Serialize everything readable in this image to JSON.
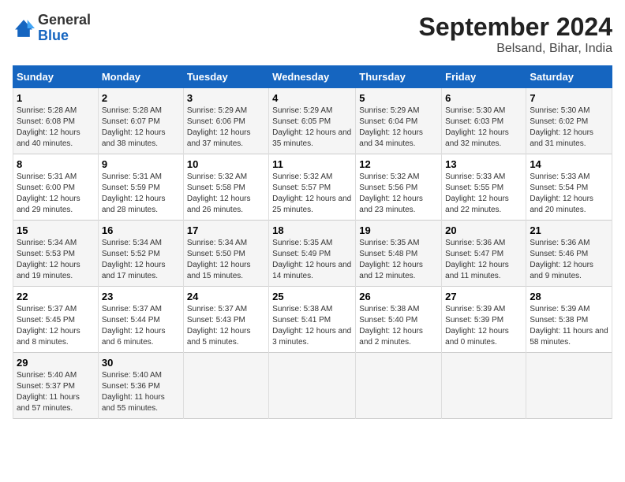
{
  "logo": {
    "general": "General",
    "blue": "Blue"
  },
  "title": "September 2024",
  "location": "Belsand, Bihar, India",
  "weekdays": [
    "Sunday",
    "Monday",
    "Tuesday",
    "Wednesday",
    "Thursday",
    "Friday",
    "Saturday"
  ],
  "weeks": [
    [
      {
        "day": "1",
        "sunrise": "Sunrise: 5:28 AM",
        "sunset": "Sunset: 6:08 PM",
        "daylight": "Daylight: 12 hours and 40 minutes."
      },
      {
        "day": "2",
        "sunrise": "Sunrise: 5:28 AM",
        "sunset": "Sunset: 6:07 PM",
        "daylight": "Daylight: 12 hours and 38 minutes."
      },
      {
        "day": "3",
        "sunrise": "Sunrise: 5:29 AM",
        "sunset": "Sunset: 6:06 PM",
        "daylight": "Daylight: 12 hours and 37 minutes."
      },
      {
        "day": "4",
        "sunrise": "Sunrise: 5:29 AM",
        "sunset": "Sunset: 6:05 PM",
        "daylight": "Daylight: 12 hours and 35 minutes."
      },
      {
        "day": "5",
        "sunrise": "Sunrise: 5:29 AM",
        "sunset": "Sunset: 6:04 PM",
        "daylight": "Daylight: 12 hours and 34 minutes."
      },
      {
        "day": "6",
        "sunrise": "Sunrise: 5:30 AM",
        "sunset": "Sunset: 6:03 PM",
        "daylight": "Daylight: 12 hours and 32 minutes."
      },
      {
        "day": "7",
        "sunrise": "Sunrise: 5:30 AM",
        "sunset": "Sunset: 6:02 PM",
        "daylight": "Daylight: 12 hours and 31 minutes."
      }
    ],
    [
      {
        "day": "8",
        "sunrise": "Sunrise: 5:31 AM",
        "sunset": "Sunset: 6:00 PM",
        "daylight": "Daylight: 12 hours and 29 minutes."
      },
      {
        "day": "9",
        "sunrise": "Sunrise: 5:31 AM",
        "sunset": "Sunset: 5:59 PM",
        "daylight": "Daylight: 12 hours and 28 minutes."
      },
      {
        "day": "10",
        "sunrise": "Sunrise: 5:32 AM",
        "sunset": "Sunset: 5:58 PM",
        "daylight": "Daylight: 12 hours and 26 minutes."
      },
      {
        "day": "11",
        "sunrise": "Sunrise: 5:32 AM",
        "sunset": "Sunset: 5:57 PM",
        "daylight": "Daylight: 12 hours and 25 minutes."
      },
      {
        "day": "12",
        "sunrise": "Sunrise: 5:32 AM",
        "sunset": "Sunset: 5:56 PM",
        "daylight": "Daylight: 12 hours and 23 minutes."
      },
      {
        "day": "13",
        "sunrise": "Sunrise: 5:33 AM",
        "sunset": "Sunset: 5:55 PM",
        "daylight": "Daylight: 12 hours and 22 minutes."
      },
      {
        "day": "14",
        "sunrise": "Sunrise: 5:33 AM",
        "sunset": "Sunset: 5:54 PM",
        "daylight": "Daylight: 12 hours and 20 minutes."
      }
    ],
    [
      {
        "day": "15",
        "sunrise": "Sunrise: 5:34 AM",
        "sunset": "Sunset: 5:53 PM",
        "daylight": "Daylight: 12 hours and 19 minutes."
      },
      {
        "day": "16",
        "sunrise": "Sunrise: 5:34 AM",
        "sunset": "Sunset: 5:52 PM",
        "daylight": "Daylight: 12 hours and 17 minutes."
      },
      {
        "day": "17",
        "sunrise": "Sunrise: 5:34 AM",
        "sunset": "Sunset: 5:50 PM",
        "daylight": "Daylight: 12 hours and 15 minutes."
      },
      {
        "day": "18",
        "sunrise": "Sunrise: 5:35 AM",
        "sunset": "Sunset: 5:49 PM",
        "daylight": "Daylight: 12 hours and 14 minutes."
      },
      {
        "day": "19",
        "sunrise": "Sunrise: 5:35 AM",
        "sunset": "Sunset: 5:48 PM",
        "daylight": "Daylight: 12 hours and 12 minutes."
      },
      {
        "day": "20",
        "sunrise": "Sunrise: 5:36 AM",
        "sunset": "Sunset: 5:47 PM",
        "daylight": "Daylight: 12 hours and 11 minutes."
      },
      {
        "day": "21",
        "sunrise": "Sunrise: 5:36 AM",
        "sunset": "Sunset: 5:46 PM",
        "daylight": "Daylight: 12 hours and 9 minutes."
      }
    ],
    [
      {
        "day": "22",
        "sunrise": "Sunrise: 5:37 AM",
        "sunset": "Sunset: 5:45 PM",
        "daylight": "Daylight: 12 hours and 8 minutes."
      },
      {
        "day": "23",
        "sunrise": "Sunrise: 5:37 AM",
        "sunset": "Sunset: 5:44 PM",
        "daylight": "Daylight: 12 hours and 6 minutes."
      },
      {
        "day": "24",
        "sunrise": "Sunrise: 5:37 AM",
        "sunset": "Sunset: 5:43 PM",
        "daylight": "Daylight: 12 hours and 5 minutes."
      },
      {
        "day": "25",
        "sunrise": "Sunrise: 5:38 AM",
        "sunset": "Sunset: 5:41 PM",
        "daylight": "Daylight: 12 hours and 3 minutes."
      },
      {
        "day": "26",
        "sunrise": "Sunrise: 5:38 AM",
        "sunset": "Sunset: 5:40 PM",
        "daylight": "Daylight: 12 hours and 2 minutes."
      },
      {
        "day": "27",
        "sunrise": "Sunrise: 5:39 AM",
        "sunset": "Sunset: 5:39 PM",
        "daylight": "Daylight: 12 hours and 0 minutes."
      },
      {
        "day": "28",
        "sunrise": "Sunrise: 5:39 AM",
        "sunset": "Sunset: 5:38 PM",
        "daylight": "Daylight: 11 hours and 58 minutes."
      }
    ],
    [
      {
        "day": "29",
        "sunrise": "Sunrise: 5:40 AM",
        "sunset": "Sunset: 5:37 PM",
        "daylight": "Daylight: 11 hours and 57 minutes."
      },
      {
        "day": "30",
        "sunrise": "Sunrise: 5:40 AM",
        "sunset": "Sunset: 5:36 PM",
        "daylight": "Daylight: 11 hours and 55 minutes."
      },
      null,
      null,
      null,
      null,
      null
    ]
  ]
}
